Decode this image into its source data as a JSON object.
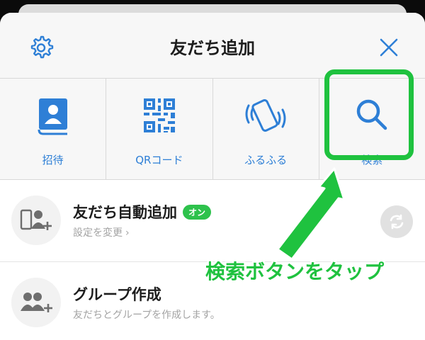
{
  "header": {
    "title": "友だち追加",
    "settings_icon": "gear-icon",
    "close_icon": "close-icon"
  },
  "actions": [
    {
      "label": "招待",
      "icon": "contact-book-icon"
    },
    {
      "label": "QRコード",
      "icon": "qr-code-icon"
    },
    {
      "label": "ふるふる",
      "icon": "shake-phone-icon"
    },
    {
      "label": "検索",
      "icon": "search-icon"
    }
  ],
  "list": {
    "auto_add": {
      "title": "友だち自動追加",
      "badge": "オン",
      "subtitle": "設定を変更",
      "chevron": "›"
    },
    "group": {
      "title": "グループ作成",
      "subtitle": "友だちとグループを作成します。"
    }
  },
  "annotation": "検索ボタンをタップ",
  "colors": {
    "accent": "#2e7fd6",
    "highlight": "#1fc23f",
    "badge": "#2ec24c"
  }
}
